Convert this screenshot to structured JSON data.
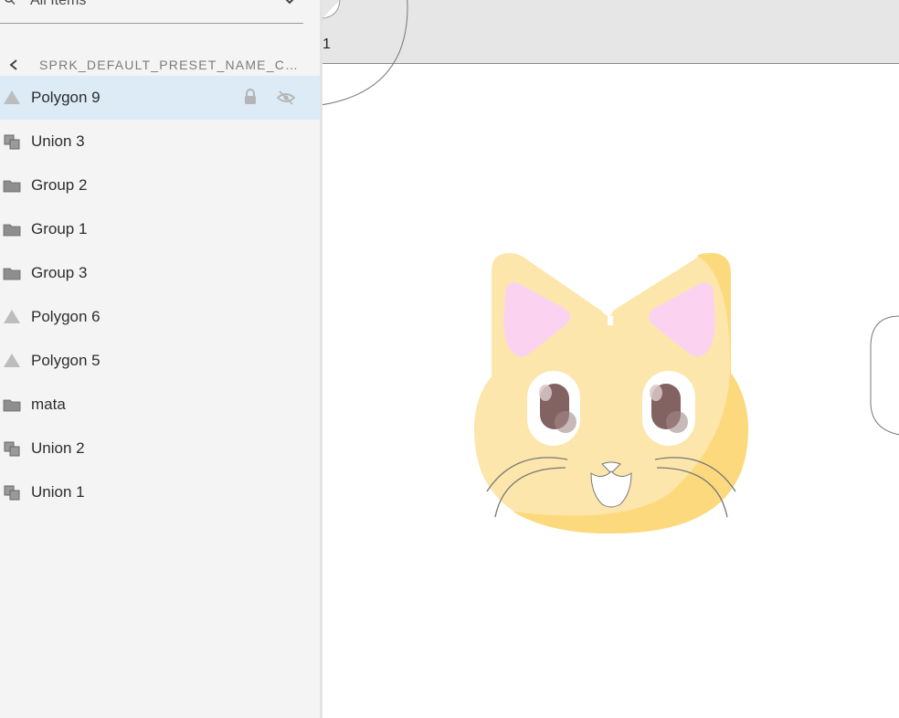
{
  "search": {
    "filter_label": "All Items"
  },
  "breadcrumb": {
    "label": "SPRK_DEFAULT_PRESET_NAME_CU..."
  },
  "layers": [
    {
      "name": "Polygon 9",
      "icon": "triangle-icon",
      "selected": true
    },
    {
      "name": "Union 3",
      "icon": "union-icon"
    },
    {
      "name": "Group 2",
      "icon": "folder-icon"
    },
    {
      "name": "Group 1",
      "icon": "folder-icon"
    },
    {
      "name": "Group 3",
      "icon": "folder-icon"
    },
    {
      "name": "Polygon 6",
      "icon": "triangle-icon"
    },
    {
      "name": "Polygon 5",
      "icon": "triangle-icon"
    },
    {
      "name": "mata",
      "icon": "folder-icon"
    },
    {
      "name": "Union 2",
      "icon": "union-icon"
    },
    {
      "name": "Union 1",
      "icon": "union-icon"
    }
  ],
  "canvas": {
    "artboard_label": "1"
  },
  "colors": {
    "panel_bg": "#f4f4f4",
    "selected_row": "#dcebf6",
    "cat_body": "#fde6ab",
    "cat_shade": "#fdd97e",
    "cat_ear_inner": "#fbd3f0",
    "cat_eye": "#836262"
  }
}
